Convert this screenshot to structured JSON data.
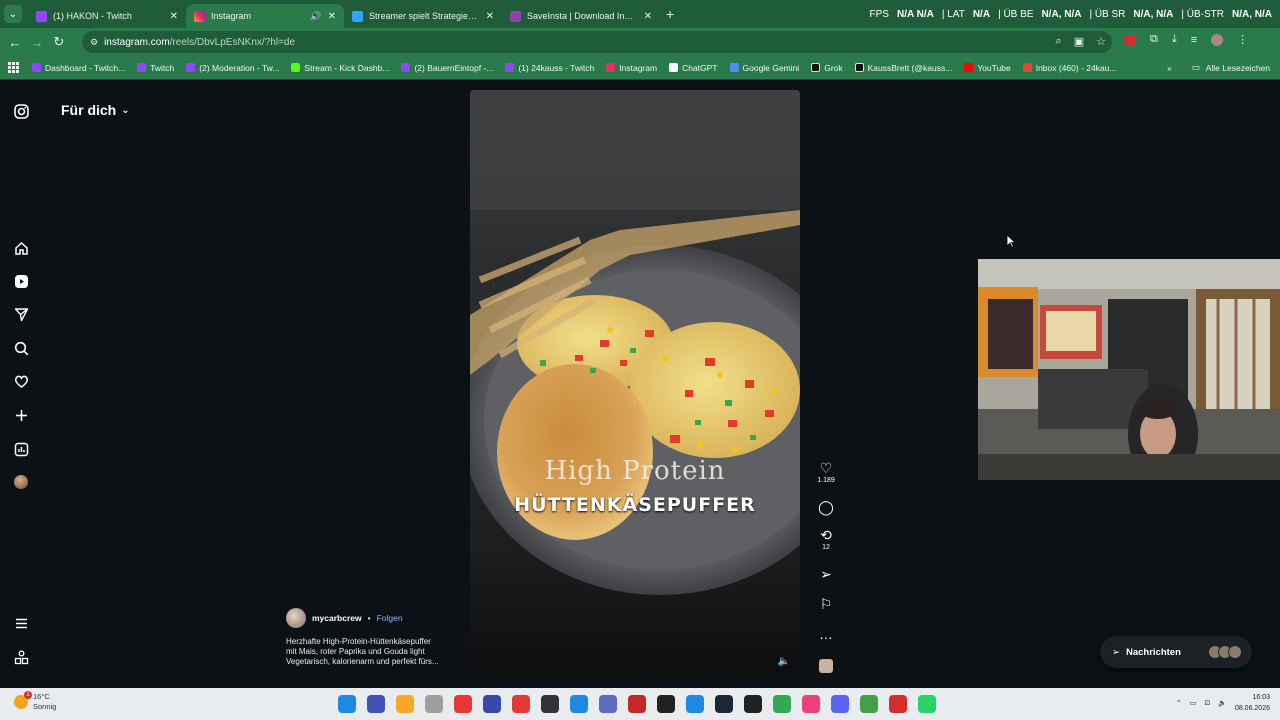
{
  "browser": {
    "tabs": [
      {
        "title": "(1) HAKON - Twitch",
        "color": "#9146ff",
        "active": false
      },
      {
        "title": "Instagram",
        "color": "#e1306c",
        "active": true
      },
      {
        "title": "Streamer spielt Strategiespiel: I",
        "color": "#2fa3ff",
        "active": false
      },
      {
        "title": "SaveInsta | Download Instagram",
        "color": "#8e44ad",
        "active": false
      }
    ],
    "new_tab": "+",
    "hud": {
      "fps_label": "FPS",
      "fps_value": "N/A N/A",
      "lat_label": "| LAT",
      "lat_value": "N/A",
      "ub_be_label": "| ÜB BE",
      "ub_be_value": "N/A, N/A",
      "ub_sr_label": "| ÜB SR",
      "ub_sr_value": "N/A, N/A",
      "ub_str_label": "| ÜB-STR",
      "ub_str_value": "N/A, N/A"
    },
    "url_domain": "instagram.com",
    "url_path": "/reels/DbvLpEsNKnx/?hl=de",
    "bookmarks": [
      {
        "label": "Dashboard - Twitch...",
        "color": "#9146ff"
      },
      {
        "label": "Twitch",
        "color": "#9146ff"
      },
      {
        "label": "(2) Moderation - Tw...",
        "color": "#9146ff"
      },
      {
        "label": "Stream - Kick Dashb...",
        "color": "#53fc18"
      },
      {
        "label": "(2) BauernEintopf -...",
        "color": "#9146ff"
      },
      {
        "label": "(1) 24kauss - Twitch",
        "color": "#9146ff"
      },
      {
        "label": "Instagram",
        "color": "#e1306c"
      },
      {
        "label": "ChatGPT",
        "color": "#ffffff"
      },
      {
        "label": "Google Gemini",
        "color": "#4f8ef7"
      },
      {
        "label": "Grok",
        "color": "#111111"
      },
      {
        "label": "KaussBrett (@kauss...",
        "color": "#111111"
      },
      {
        "label": "YouTube",
        "color": "#ff0000"
      },
      {
        "label": "Inbox (460) - 24kau...",
        "color": "#ea4335"
      }
    ],
    "bookmarks_more": "»",
    "all_bookmarks": "Alle Lesezeichen"
  },
  "instagram": {
    "feed_title": "Für dich",
    "sidebar_icons": [
      "instagram-logo-icon",
      "home-icon",
      "reels-icon",
      "send-icon",
      "search-icon",
      "heart-icon",
      "create-icon",
      "insights-icon",
      "profile-avatar-icon",
      "menu-icon",
      "more-apps-icon"
    ],
    "reel": {
      "overlay_line1": "High Protein",
      "overlay_line2": "HÜTTENKÄSEPUFFER"
    },
    "actions": {
      "likes": "1.189",
      "reposts": "12"
    },
    "author": "mycarbcrew",
    "separator": "•",
    "follow": "Folgen",
    "caption_lines": [
      "Herzhafte High-Protein-Hüttenkäsepuffer",
      "mit Mais, roter Paprika und Gouda light",
      "Vegetarisch, kalorienarm und perfekt fürs..."
    ],
    "messages_label": "Nachrichten"
  },
  "taskbar": {
    "weather_temp": "16°C",
    "weather_desc": "Sonnig",
    "weather_badge": "1",
    "time": "16:03",
    "date": "08.06.2026",
    "apps": [
      {
        "name": "windows-start-icon",
        "color": "#1e88e5"
      },
      {
        "name": "notes-icon",
        "color": "#3f51b5"
      },
      {
        "name": "file-explorer-icon",
        "color": "#f9a825"
      },
      {
        "name": "mouse-app-icon",
        "color": "#9e9e9e"
      },
      {
        "name": "opera-icon",
        "color": "#e53935"
      },
      {
        "name": "v-app-icon",
        "color": "#3949ab"
      },
      {
        "name": "record-icon",
        "color": "#e53935"
      },
      {
        "name": "obs-icon",
        "color": "#333333"
      },
      {
        "name": "game-icon",
        "color": "#1e88e5"
      },
      {
        "name": "tool-icon",
        "color": "#5c6bc0"
      },
      {
        "name": "app-red-icon",
        "color": "#c62828"
      },
      {
        "name": "chatgpt-icon",
        "color": "#222222"
      },
      {
        "name": "edge-icon",
        "color": "#1e88e5"
      },
      {
        "name": "steam-icon",
        "color": "#1b2838"
      },
      {
        "name": "epic-games-icon",
        "color": "#222222"
      },
      {
        "name": "chrome-icon",
        "color": "#34a853"
      },
      {
        "name": "app-pink-icon",
        "color": "#ec407a"
      },
      {
        "name": "discord-icon",
        "color": "#5865f2"
      },
      {
        "name": "app-green-icon",
        "color": "#43a047"
      },
      {
        "name": "app-news-icon",
        "color": "#d32f2f"
      },
      {
        "name": "whatsapp-icon",
        "color": "#25d366"
      }
    ]
  }
}
